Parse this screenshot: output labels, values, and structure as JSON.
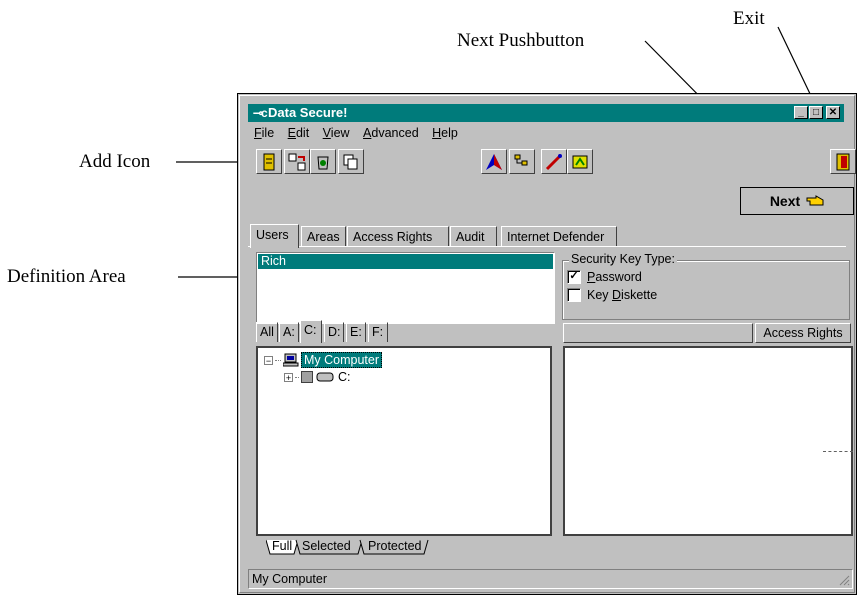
{
  "callouts": {
    "exit": "Exit",
    "next_pushbutton": "Next Pushbutton",
    "add_icon": "Add Icon",
    "definition_area": "Definition Area"
  },
  "window": {
    "title": "Data Secure!",
    "icon": "key-icon",
    "controls": [
      "minimize-icon",
      "maximize-icon",
      "close-icon"
    ]
  },
  "menu": [
    {
      "label": "File",
      "mnemonic": "F"
    },
    {
      "label": "Edit",
      "mnemonic": "E"
    },
    {
      "label": "View",
      "mnemonic": "V"
    },
    {
      "label": "Advanced",
      "mnemonic": "A"
    },
    {
      "label": "Help",
      "mnemonic": "H"
    }
  ],
  "toolbar": {
    "icons": [
      "add-icon",
      "move-icon",
      "recycle-icon",
      "copy-icon",
      "arrow-logo-icon",
      "tree-icon",
      "wand-icon",
      "key-cert-icon",
      "exit-door-icon"
    ]
  },
  "next_button": {
    "label": "Next",
    "icon": "pointing-hand-icon"
  },
  "tabs": [
    "Users",
    "Areas",
    "Access Rights",
    "Audit",
    "Internet Defender"
  ],
  "active_tab": "Users",
  "definition": {
    "selected_user": "Rich"
  },
  "security_key": {
    "title": "Security Key Type:",
    "options": [
      {
        "label": "Password",
        "checked": true
      },
      {
        "label": "Key Diskette",
        "checked": false
      }
    ]
  },
  "drive_tabs": [
    "All",
    "A:",
    "C:",
    "D:",
    "E:",
    "F:"
  ],
  "active_drive": "C:",
  "tree": {
    "root": "My Computer",
    "child": "C:"
  },
  "right_pane": {
    "column": "Access Rights"
  },
  "bottom_tabs": [
    "Full",
    "Selected",
    "Protected"
  ],
  "status": "My Computer",
  "colors": {
    "title_bar": "#007b7b",
    "selection": "#007b7b",
    "face": "#c0c0c0"
  }
}
